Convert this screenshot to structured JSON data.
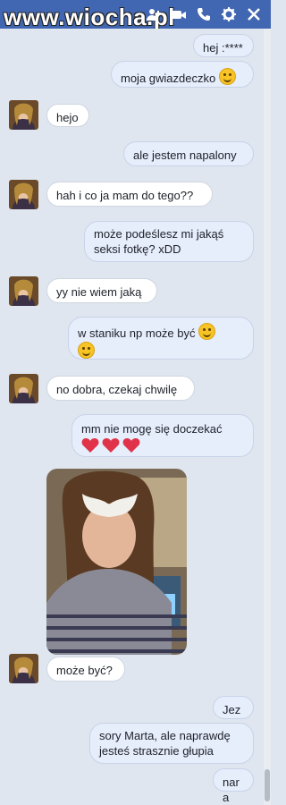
{
  "watermark": "www.wiocha.pl",
  "header_icons": [
    "add-people-icon",
    "video-camera-icon",
    "phone-icon",
    "gear-icon",
    "close-icon"
  ],
  "colors": {
    "header": "#4267b2",
    "background": "#dfe6ef",
    "outgoing_bubble": "#e6edfb",
    "incoming_bubble": "#ffffff"
  },
  "messages": [
    {
      "from": "me",
      "text": "hej :****"
    },
    {
      "from": "me",
      "text": "moja gwiazdeczko",
      "emoji": "kissing-face-icon"
    },
    {
      "from": "her",
      "text": "hejo"
    },
    {
      "from": "me",
      "text": "ale jestem napalony"
    },
    {
      "from": "her",
      "text": "hah i co ja mam do tego??"
    },
    {
      "from": "me",
      "text": "może podeślesz mi jakąś seksi fotkę? xDD"
    },
    {
      "from": "her",
      "text": "yy nie wiem jaką"
    },
    {
      "from": "me",
      "text": "w staniku np może być",
      "emoji": "grinning-face-icon"
    },
    {
      "from": "her",
      "text": "no dobra, czekaj chwilę"
    },
    {
      "from": "me",
      "text": "mm nie mogę się doczekać",
      "emoji": "heart-icon"
    },
    {
      "from": "her",
      "type": "photo"
    },
    {
      "from": "her",
      "text": "może być?"
    },
    {
      "from": "me",
      "text": "Jezu"
    },
    {
      "from": "me",
      "text": "sory Marta, ale naprawdę jesteś strasznie głupia"
    },
    {
      "from": "me",
      "text": "nara"
    }
  ]
}
